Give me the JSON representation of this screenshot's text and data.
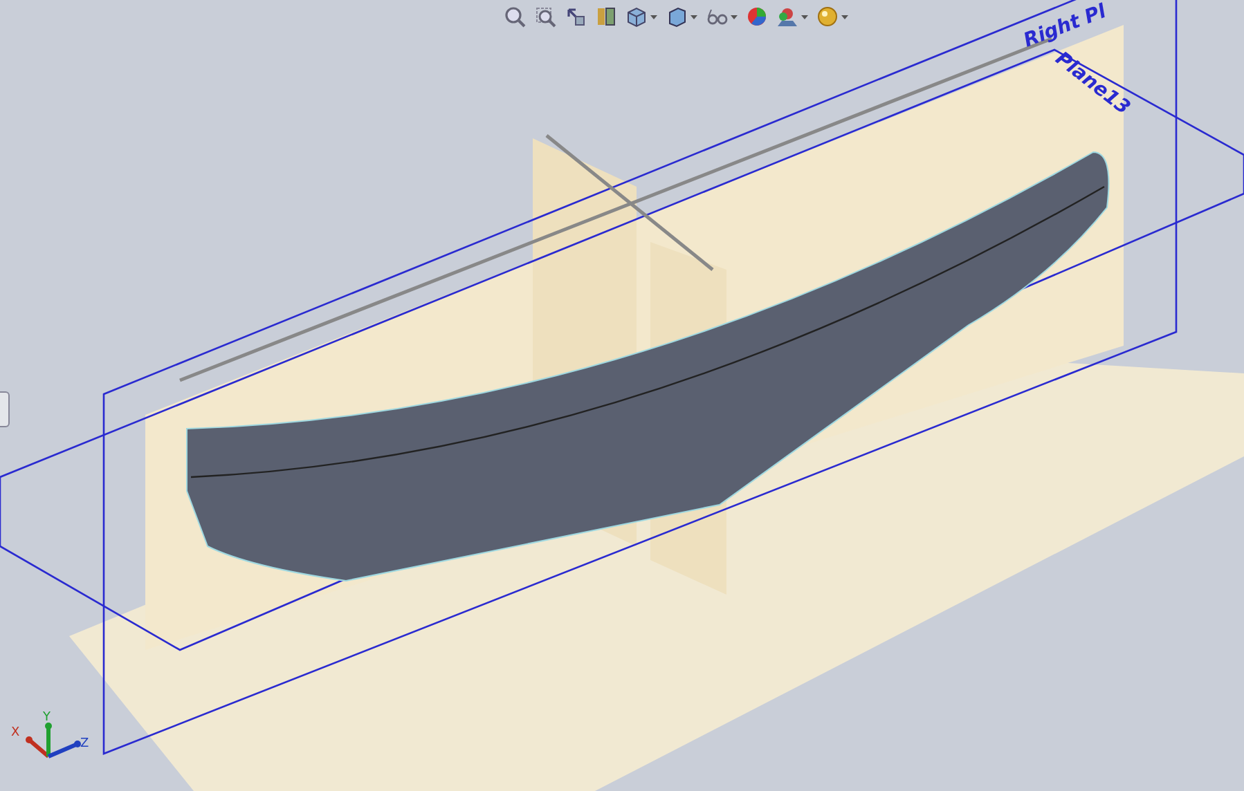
{
  "toolbar": [
    {
      "kind": "zoom-fit",
      "dropdown": false
    },
    {
      "kind": "zoom-area",
      "dropdown": false
    },
    {
      "kind": "previous-view",
      "dropdown": false
    },
    {
      "kind": "section",
      "dropdown": false
    },
    {
      "kind": "orientation",
      "dropdown": true
    },
    {
      "kind": "display-style",
      "dropdown": true
    },
    {
      "kind": "hide-show",
      "dropdown": true
    },
    {
      "kind": "appearance",
      "dropdown": false
    },
    {
      "kind": "scene",
      "dropdown": true
    },
    {
      "kind": "view-settings",
      "dropdown": true
    }
  ],
  "plane_labels": [
    {
      "kind": "right",
      "text": "Right Pl"
    },
    {
      "kind": "plane13",
      "text": "Plane13"
    }
  ],
  "triad": {
    "axes": [
      "X",
      "Y",
      "Z"
    ]
  }
}
